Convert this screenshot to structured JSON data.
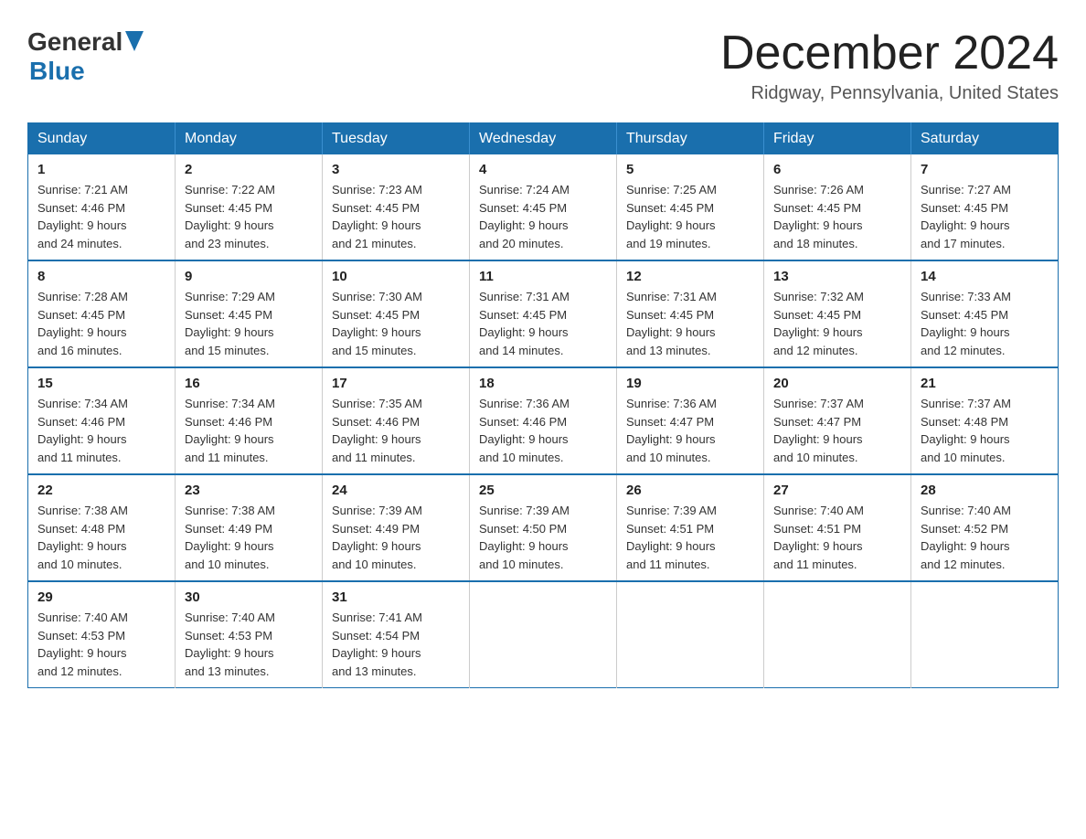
{
  "header": {
    "logo": {
      "general": "General",
      "blue": "Blue"
    },
    "title": "December 2024",
    "location": "Ridgway, Pennsylvania, United States"
  },
  "weekdays": [
    "Sunday",
    "Monday",
    "Tuesday",
    "Wednesday",
    "Thursday",
    "Friday",
    "Saturday"
  ],
  "weeks": [
    [
      {
        "day": "1",
        "sunrise": "Sunrise: 7:21 AM",
        "sunset": "Sunset: 4:46 PM",
        "daylight": "Daylight: 9 hours",
        "minutes": "and 24 minutes."
      },
      {
        "day": "2",
        "sunrise": "Sunrise: 7:22 AM",
        "sunset": "Sunset: 4:45 PM",
        "daylight": "Daylight: 9 hours",
        "minutes": "and 23 minutes."
      },
      {
        "day": "3",
        "sunrise": "Sunrise: 7:23 AM",
        "sunset": "Sunset: 4:45 PM",
        "daylight": "Daylight: 9 hours",
        "minutes": "and 21 minutes."
      },
      {
        "day": "4",
        "sunrise": "Sunrise: 7:24 AM",
        "sunset": "Sunset: 4:45 PM",
        "daylight": "Daylight: 9 hours",
        "minutes": "and 20 minutes."
      },
      {
        "day": "5",
        "sunrise": "Sunrise: 7:25 AM",
        "sunset": "Sunset: 4:45 PM",
        "daylight": "Daylight: 9 hours",
        "minutes": "and 19 minutes."
      },
      {
        "day": "6",
        "sunrise": "Sunrise: 7:26 AM",
        "sunset": "Sunset: 4:45 PM",
        "daylight": "Daylight: 9 hours",
        "minutes": "and 18 minutes."
      },
      {
        "day": "7",
        "sunrise": "Sunrise: 7:27 AM",
        "sunset": "Sunset: 4:45 PM",
        "daylight": "Daylight: 9 hours",
        "minutes": "and 17 minutes."
      }
    ],
    [
      {
        "day": "8",
        "sunrise": "Sunrise: 7:28 AM",
        "sunset": "Sunset: 4:45 PM",
        "daylight": "Daylight: 9 hours",
        "minutes": "and 16 minutes."
      },
      {
        "day": "9",
        "sunrise": "Sunrise: 7:29 AM",
        "sunset": "Sunset: 4:45 PM",
        "daylight": "Daylight: 9 hours",
        "minutes": "and 15 minutes."
      },
      {
        "day": "10",
        "sunrise": "Sunrise: 7:30 AM",
        "sunset": "Sunset: 4:45 PM",
        "daylight": "Daylight: 9 hours",
        "minutes": "and 15 minutes."
      },
      {
        "day": "11",
        "sunrise": "Sunrise: 7:31 AM",
        "sunset": "Sunset: 4:45 PM",
        "daylight": "Daylight: 9 hours",
        "minutes": "and 14 minutes."
      },
      {
        "day": "12",
        "sunrise": "Sunrise: 7:31 AM",
        "sunset": "Sunset: 4:45 PM",
        "daylight": "Daylight: 9 hours",
        "minutes": "and 13 minutes."
      },
      {
        "day": "13",
        "sunrise": "Sunrise: 7:32 AM",
        "sunset": "Sunset: 4:45 PM",
        "daylight": "Daylight: 9 hours",
        "minutes": "and 12 minutes."
      },
      {
        "day": "14",
        "sunrise": "Sunrise: 7:33 AM",
        "sunset": "Sunset: 4:45 PM",
        "daylight": "Daylight: 9 hours",
        "minutes": "and 12 minutes."
      }
    ],
    [
      {
        "day": "15",
        "sunrise": "Sunrise: 7:34 AM",
        "sunset": "Sunset: 4:46 PM",
        "daylight": "Daylight: 9 hours",
        "minutes": "and 11 minutes."
      },
      {
        "day": "16",
        "sunrise": "Sunrise: 7:34 AM",
        "sunset": "Sunset: 4:46 PM",
        "daylight": "Daylight: 9 hours",
        "minutes": "and 11 minutes."
      },
      {
        "day": "17",
        "sunrise": "Sunrise: 7:35 AM",
        "sunset": "Sunset: 4:46 PM",
        "daylight": "Daylight: 9 hours",
        "minutes": "and 11 minutes."
      },
      {
        "day": "18",
        "sunrise": "Sunrise: 7:36 AM",
        "sunset": "Sunset: 4:46 PM",
        "daylight": "Daylight: 9 hours",
        "minutes": "and 10 minutes."
      },
      {
        "day": "19",
        "sunrise": "Sunrise: 7:36 AM",
        "sunset": "Sunset: 4:47 PM",
        "daylight": "Daylight: 9 hours",
        "minutes": "and 10 minutes."
      },
      {
        "day": "20",
        "sunrise": "Sunrise: 7:37 AM",
        "sunset": "Sunset: 4:47 PM",
        "daylight": "Daylight: 9 hours",
        "minutes": "and 10 minutes."
      },
      {
        "day": "21",
        "sunrise": "Sunrise: 7:37 AM",
        "sunset": "Sunset: 4:48 PM",
        "daylight": "Daylight: 9 hours",
        "minutes": "and 10 minutes."
      }
    ],
    [
      {
        "day": "22",
        "sunrise": "Sunrise: 7:38 AM",
        "sunset": "Sunset: 4:48 PM",
        "daylight": "Daylight: 9 hours",
        "minutes": "and 10 minutes."
      },
      {
        "day": "23",
        "sunrise": "Sunrise: 7:38 AM",
        "sunset": "Sunset: 4:49 PM",
        "daylight": "Daylight: 9 hours",
        "minutes": "and 10 minutes."
      },
      {
        "day": "24",
        "sunrise": "Sunrise: 7:39 AM",
        "sunset": "Sunset: 4:49 PM",
        "daylight": "Daylight: 9 hours",
        "minutes": "and 10 minutes."
      },
      {
        "day": "25",
        "sunrise": "Sunrise: 7:39 AM",
        "sunset": "Sunset: 4:50 PM",
        "daylight": "Daylight: 9 hours",
        "minutes": "and 10 minutes."
      },
      {
        "day": "26",
        "sunrise": "Sunrise: 7:39 AM",
        "sunset": "Sunset: 4:51 PM",
        "daylight": "Daylight: 9 hours",
        "minutes": "and 11 minutes."
      },
      {
        "day": "27",
        "sunrise": "Sunrise: 7:40 AM",
        "sunset": "Sunset: 4:51 PM",
        "daylight": "Daylight: 9 hours",
        "minutes": "and 11 minutes."
      },
      {
        "day": "28",
        "sunrise": "Sunrise: 7:40 AM",
        "sunset": "Sunset: 4:52 PM",
        "daylight": "Daylight: 9 hours",
        "minutes": "and 12 minutes."
      }
    ],
    [
      {
        "day": "29",
        "sunrise": "Sunrise: 7:40 AM",
        "sunset": "Sunset: 4:53 PM",
        "daylight": "Daylight: 9 hours",
        "minutes": "and 12 minutes."
      },
      {
        "day": "30",
        "sunrise": "Sunrise: 7:40 AM",
        "sunset": "Sunset: 4:53 PM",
        "daylight": "Daylight: 9 hours",
        "minutes": "and 13 minutes."
      },
      {
        "day": "31",
        "sunrise": "Sunrise: 7:41 AM",
        "sunset": "Sunset: 4:54 PM",
        "daylight": "Daylight: 9 hours",
        "minutes": "and 13 minutes."
      },
      null,
      null,
      null,
      null
    ]
  ]
}
